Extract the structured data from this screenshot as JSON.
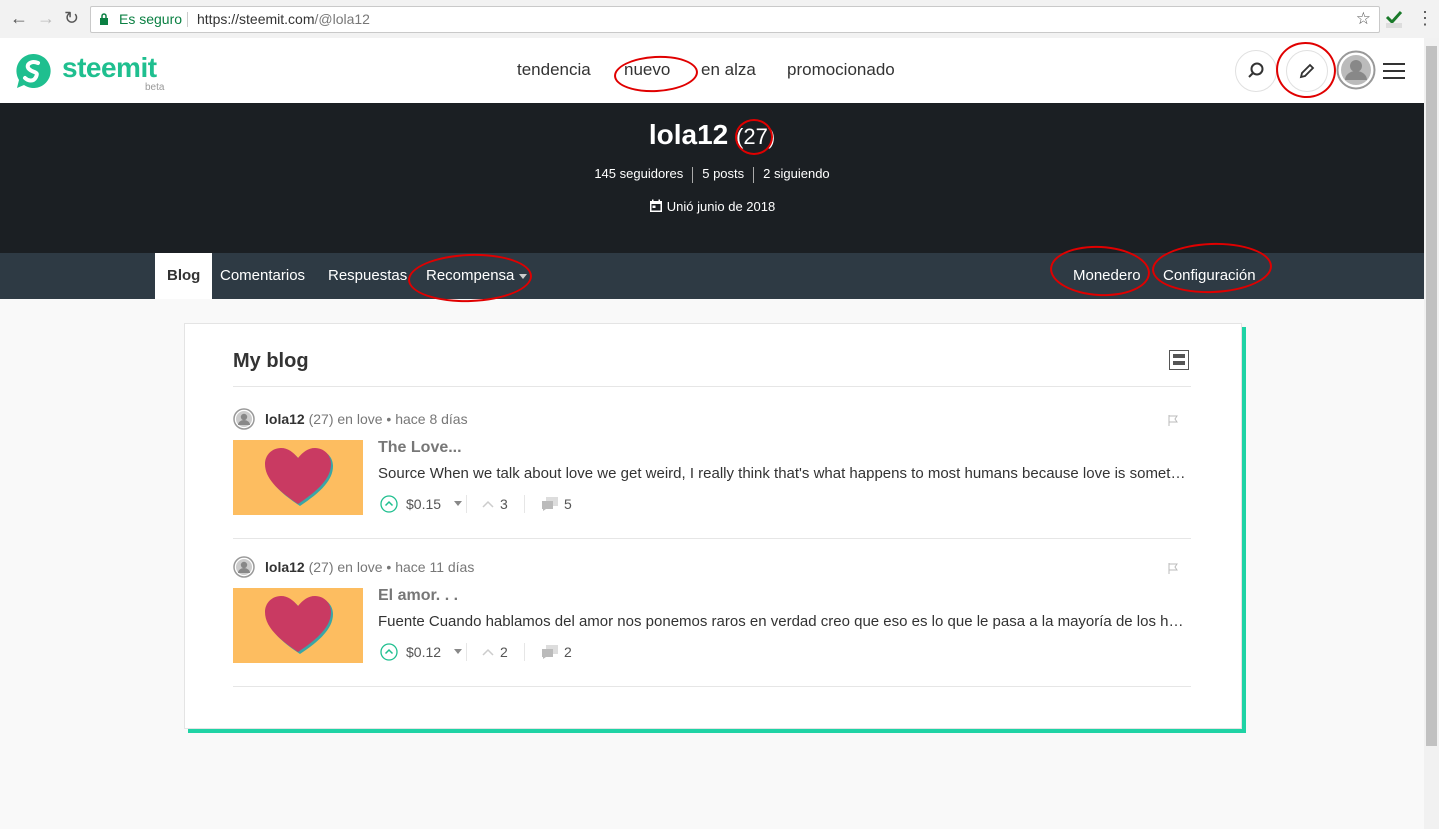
{
  "browser": {
    "secure_label": "Es seguro",
    "url_host": "https://steemit.com",
    "url_path": "/@lola12",
    "back_icon": "←",
    "forward_icon": "→",
    "reload_icon": "↻",
    "star_icon": "☆",
    "menu_icon": "⋮"
  },
  "header": {
    "brand": "steemit",
    "beta": "beta",
    "nav": [
      "tendencia",
      "nuevo",
      "en alza",
      "promocionado"
    ]
  },
  "profile": {
    "name": "lola12",
    "reputation": "(27)",
    "followers": "145 seguidores",
    "posts": "5 posts",
    "following": "2 siguiendo",
    "joined": "Unió junio de 2018"
  },
  "tabs": {
    "left": [
      "Blog",
      "Comentarios",
      "Respuestas",
      "Recompensa"
    ],
    "right": [
      "Monedero",
      "Configuración"
    ]
  },
  "blog": {
    "title": "My blog",
    "posts": [
      {
        "author": "lola12",
        "meta_rest": "(27) en love • hace 8 días",
        "title": "The Love...",
        "excerpt": "Source When we talk about love we get weird, I really think that's what happens to most humans because love is something we can't always explain",
        "payout": "$0.15",
        "votes": "3",
        "comments": "5"
      },
      {
        "author": "lola12",
        "meta_rest": "(27) en love • hace 11 días",
        "title": "El amor. . .",
        "excerpt": "Fuente Cuando hablamos del amor nos ponemos raros en verdad creo que eso es lo que le pasa a la mayoría de los humanos",
        "payout": "$0.12",
        "votes": "2",
        "comments": "2"
      }
    ]
  },
  "colors": {
    "brand": "#1fbf8f",
    "banner": "#1b1f23",
    "tabs_bar": "#2e3a44",
    "card_accent": "#1fd3a5",
    "annotation": "#e00000"
  }
}
